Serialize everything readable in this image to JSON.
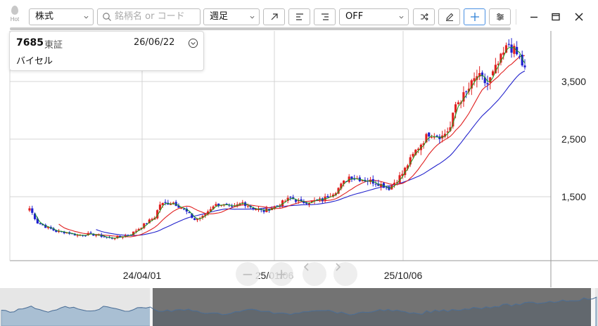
{
  "toolbar": {
    "hot_label": "Hot",
    "market_select": "株式",
    "search_placeholder": "銘柄名 or コード",
    "period_select": "週足",
    "indicator_select": "OFF"
  },
  "info": {
    "code": "7685",
    "market": "東証",
    "date": "26/06/22",
    "name": "バイセル"
  },
  "axis": {
    "price_labels": [
      "3,500",
      "2,500",
      "1,500"
    ],
    "date_labels": [
      "24/04/01",
      "25/01/06",
      "25/10/06"
    ]
  },
  "colors": {
    "up": "#e02020",
    "down": "#2020d0",
    "ma_short": "#1a9a1a",
    "ma_mid": "#e02020",
    "ma_long": "#2222cc",
    "accent": "#4a90e2"
  }
}
